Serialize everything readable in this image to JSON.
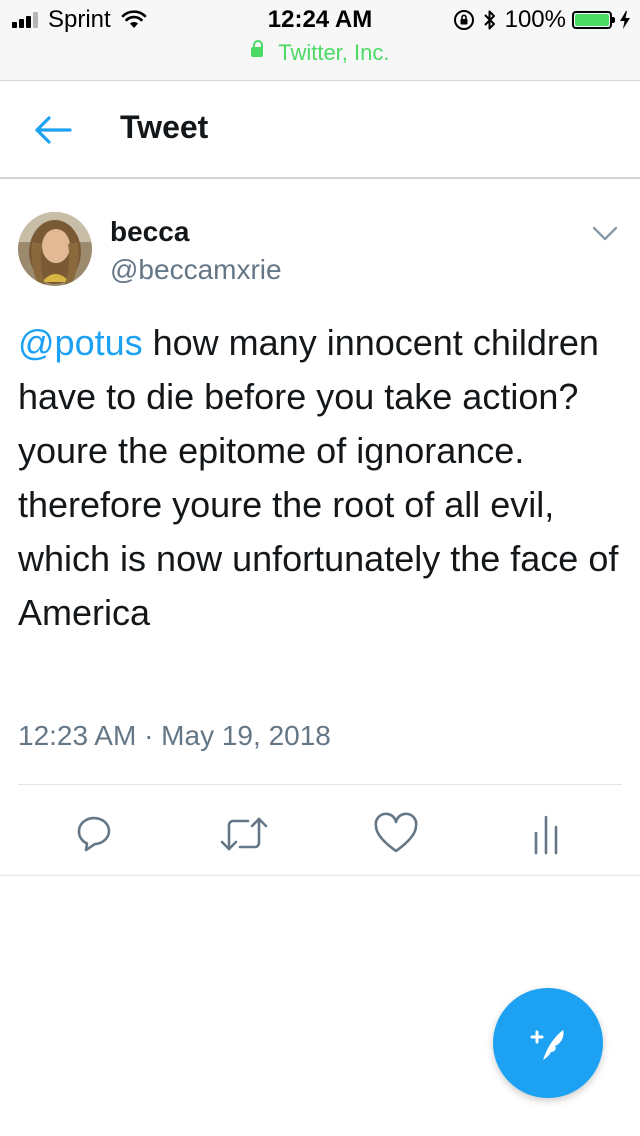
{
  "status_bar": {
    "carrier": "Sprint",
    "time": "12:24 AM",
    "battery_percent": "100%",
    "url_label": "Twitter, Inc.",
    "battery_color": "#4cd964",
    "secure_color": "#4cd964",
    "icons": [
      "signal-icon",
      "wifi-icon",
      "rotation-lock-icon",
      "bluetooth-icon",
      "battery-icon",
      "charging-icon",
      "lock-icon"
    ]
  },
  "header": {
    "title": "Tweet",
    "back_icon": "back-arrow-icon"
  },
  "tweet": {
    "display_name": "becca",
    "handle": "@beccamxrie",
    "mention": "@potus",
    "text": " how many innocent children have to die before you take action? youre the epitome of ignorance. therefore youre the root of all evil, which is now unfortunately the face of America",
    "timestamp": "12:23 AM · May 19, 2018"
  },
  "actions": [
    "reply-icon",
    "retweet-icon",
    "like-icon",
    "analytics-icon"
  ],
  "compose_icon": "compose-tweet-icon",
  "colors": {
    "accent": "#1da1f2",
    "text": "#14171a",
    "secondary": "#657786",
    "divider": "#e1e8ed"
  }
}
